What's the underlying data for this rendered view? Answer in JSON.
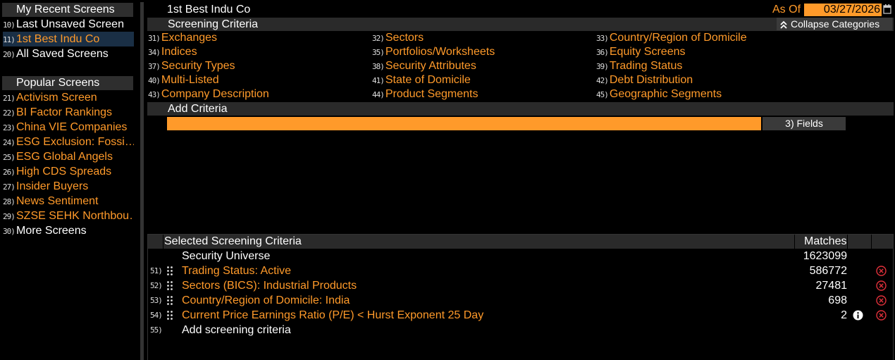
{
  "sidebar": {
    "recent_header": "My Recent Screens",
    "recent": [
      {
        "num": "10)",
        "label": "Last Unsaved Screen",
        "style": "white"
      },
      {
        "num": "11)",
        "label": "1st Best Indu Co",
        "style": "selected"
      },
      {
        "num": "20)",
        "label": "All Saved Screens",
        "style": "white"
      }
    ],
    "popular_header": "Popular Screens",
    "popular": [
      {
        "num": "21)",
        "label": "Activism Screen"
      },
      {
        "num": "22)",
        "label": "BI Factor Rankings"
      },
      {
        "num": "23)",
        "label": "China VIE Companies"
      },
      {
        "num": "24)",
        "label": "ESG Exclusion: Fossi…"
      },
      {
        "num": "25)",
        "label": "ESG Global Angels"
      },
      {
        "num": "26)",
        "label": "High CDS Spreads"
      },
      {
        "num": "27)",
        "label": "Insider Buyers"
      },
      {
        "num": "28)",
        "label": "News Sentiment"
      },
      {
        "num": "29)",
        "label": "SZSE SEHK Northbou…"
      }
    ],
    "more": {
      "num": "30)",
      "label": "More Screens"
    }
  },
  "header": {
    "title": "1st Best Indu Co",
    "as_of_label": "As Of",
    "as_of_date": "03/27/2026"
  },
  "screening": {
    "title": "Screening Criteria",
    "collapse_label": "Collapse Categories",
    "criteria": [
      [
        {
          "num": "31)",
          "label": "Exchanges"
        },
        {
          "num": "32)",
          "label": "Sectors"
        },
        {
          "num": "33)",
          "label": "Country/Region of Domicile"
        }
      ],
      [
        {
          "num": "34)",
          "label": "Indices"
        },
        {
          "num": "35)",
          "label": "Portfolios/Worksheets"
        },
        {
          "num": "36)",
          "label": "Equity Screens"
        }
      ],
      [
        {
          "num": "37)",
          "label": "Security Types"
        },
        {
          "num": "38)",
          "label": "Security Attributes"
        },
        {
          "num": "39)",
          "label": "Trading Status"
        }
      ],
      [
        {
          "num": "40)",
          "label": "Multi-Listed"
        },
        {
          "num": "41)",
          "label": "State of Domicile"
        },
        {
          "num": "42)",
          "label": "Debt Distribution"
        }
      ],
      [
        {
          "num": "43)",
          "label": "Company Description"
        },
        {
          "num": "44)",
          "label": "Product Segments"
        },
        {
          "num": "45)",
          "label": "Geographic Segments"
        }
      ]
    ]
  },
  "add_criteria": {
    "title": "Add Criteria",
    "input_value": "",
    "fields_button": "3) Fields"
  },
  "selected": {
    "header": "Selected Screening Criteria",
    "matches_header": "Matches",
    "rows": [
      {
        "num": "",
        "label": "Security Universe",
        "matches": "1623099",
        "grip": false,
        "info": false,
        "remove": false,
        "style": "white"
      },
      {
        "num": "51)",
        "label": "Trading Status: Active",
        "matches": "586772",
        "grip": true,
        "info": false,
        "remove": true,
        "style": "orange"
      },
      {
        "num": "52)",
        "label": "Sectors (BICS): Industrial Products",
        "matches": "27481",
        "grip": true,
        "info": false,
        "remove": true,
        "style": "orange"
      },
      {
        "num": "53)",
        "label": "Country/Region of Domicile: India",
        "matches": "698",
        "grip": true,
        "info": false,
        "remove": true,
        "style": "orange"
      },
      {
        "num": "54)",
        "label": "Current Price Earnings Ratio (P/E) < Hurst Exponent 25 Day",
        "matches": "2",
        "grip": true,
        "info": true,
        "remove": true,
        "style": "orange"
      },
      {
        "num": "55)",
        "label": "Add screening criteria",
        "matches": "",
        "grip": false,
        "info": false,
        "remove": false,
        "style": "white"
      }
    ]
  },
  "colors": {
    "accent": "#ff9a2a",
    "remove": "#e0303a",
    "selected_bg": "#1a2f45"
  }
}
